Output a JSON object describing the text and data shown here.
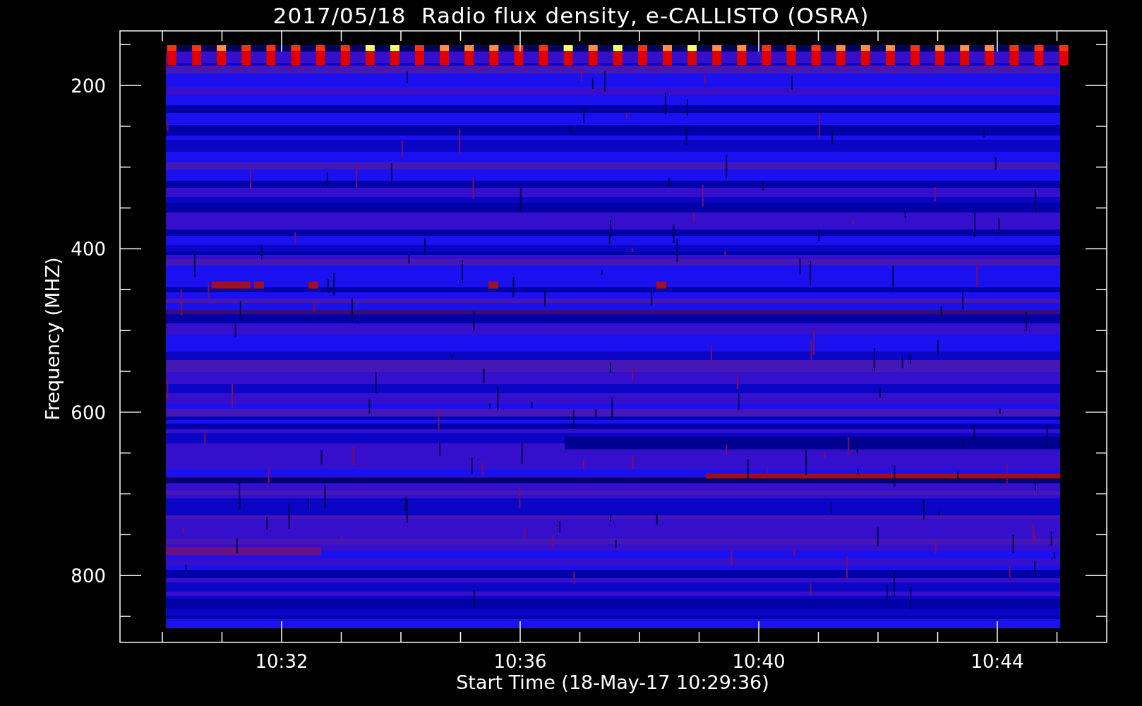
{
  "title": "2017/05/18  Radio flux density, e-CALLISTO (OSRA)",
  "y_axis": {
    "label": "Frequency (MHZ)",
    "ticks": [
      "200",
      "400",
      "600",
      "800"
    ]
  },
  "x_axis": {
    "label": "Start Time (18-May-17 10:29:36)",
    "ticks": [
      "10:32",
      "10:36",
      "10:40",
      "10:44"
    ]
  }
}
